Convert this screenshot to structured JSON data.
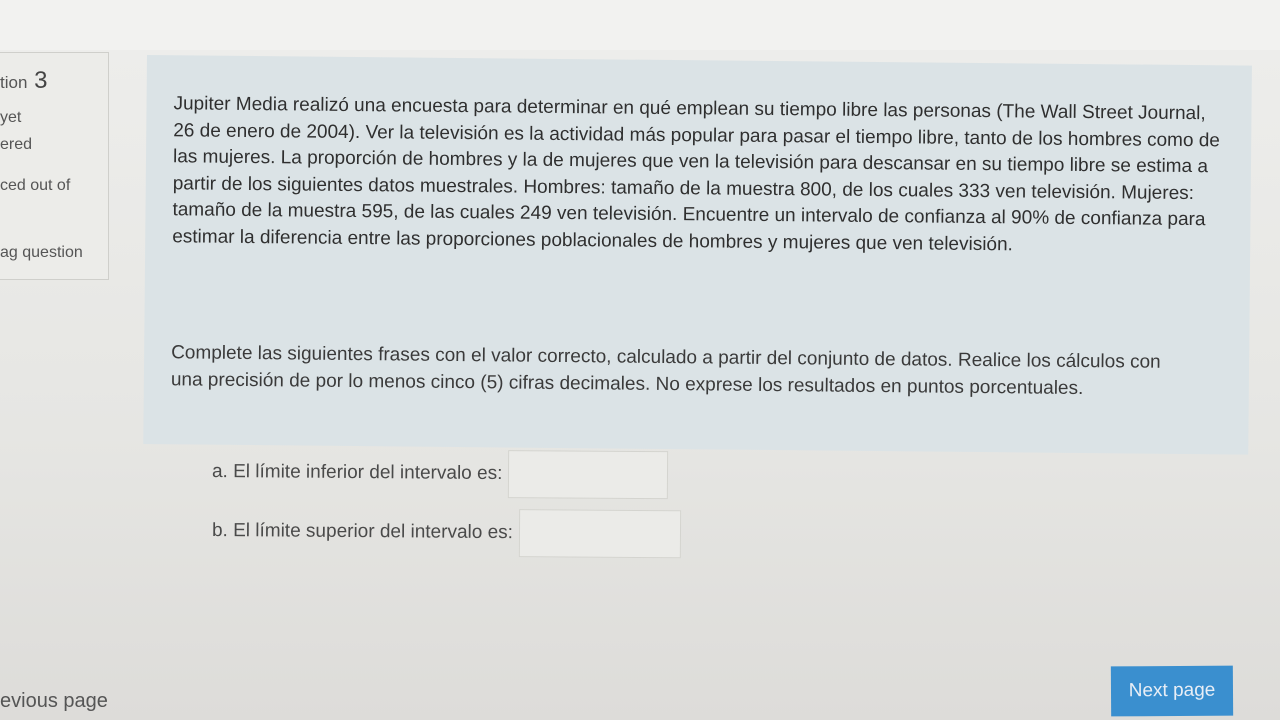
{
  "sidebar": {
    "question_label": "tion",
    "question_number": "3",
    "state_line1": "yet",
    "state_line2": "ered",
    "marked_out_of": "ced out of",
    "flag_question": "ag question"
  },
  "question": {
    "text": "Jupiter Media realizó una encuesta para determinar en qué emplean su tiempo libre las personas (The Wall Street Journal, 26 de enero de 2004). Ver la televisión es la actividad más popular para pasar el tiempo libre, tanto de los hombres como de las mujeres. La proporción de hombres y la de mujeres que ven la televisión para descansar en su tiempo libre se estima a partir de los siguientes datos muestrales. Hombres: tamaño de la muestra 800, de los cuales 333 ven televisión. Mujeres: tamaño de la muestra 595, de las cuales 249 ven televisión. Encuentre un intervalo de confianza al 90% de confianza para estimar la diferencia entre las proporciones poblacionales de hombres y mujeres que ven televisión.",
    "instructions": "Complete las siguientes frases con el valor correcto, calculado a partir del conjunto de datos. Realice los cálculos con una precisión de por lo menos cinco (5) cifras decimales. No exprese los resultados en puntos porcentuales.",
    "answers": [
      {
        "label": "a. El límite inferior del intervalo es:",
        "value": ""
      },
      {
        "label": "b. El límite superior del intervalo es:",
        "value": ""
      }
    ]
  },
  "navigation": {
    "previous_page": "evious page",
    "next_page": "Next page"
  },
  "colors": {
    "question_box": "#dbe3e6",
    "next_button": "#3a8fcf"
  }
}
